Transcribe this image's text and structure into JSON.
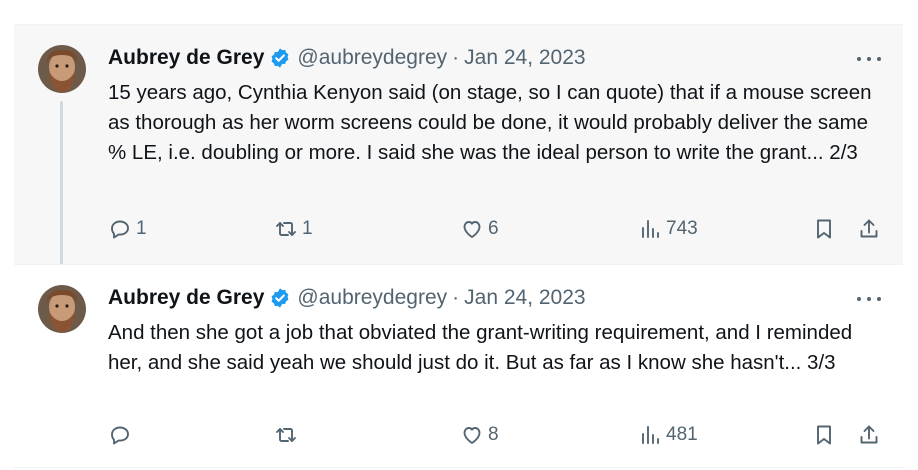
{
  "tweets": [
    {
      "author_name": "Aubrey de Grey",
      "handle": "@aubreydegrey",
      "separator": "·",
      "date": "Jan 24, 2023",
      "text": "15 years ago, Cynthia Kenyon said (on stage, so I can quote) that if a mouse screen as thorough as her worm screens could be done, it would probably deliver the same % LE, i.e. doubling or more. I said she was the ideal person to write the grant... 2/3",
      "replies": "1",
      "reposts": "1",
      "likes": "6",
      "views": "743"
    },
    {
      "author_name": "Aubrey de Grey",
      "handle": "@aubreydegrey",
      "separator": "·",
      "date": "Jan 24, 2023",
      "text": "And then she got a job that obviated the grant-writing requirement, and I reminded her, and she said yeah we should just do it. But as far as I know she hasn't... 3/3",
      "replies": "",
      "reposts": "",
      "likes": "8",
      "views": "481"
    }
  ],
  "icons": {
    "verified": "verified-badge-icon",
    "more": "more-dots-icon",
    "reply": "reply-icon",
    "repost": "repost-icon",
    "like": "heart-icon",
    "views": "views-bar-chart-icon",
    "bookmark": "bookmark-icon",
    "share": "share-upload-icon"
  },
  "colors": {
    "verified_blue": "#1d9bf0",
    "text_primary": "#0f1419",
    "text_secondary": "#536471",
    "highlight_background": "#f7f7f7"
  }
}
